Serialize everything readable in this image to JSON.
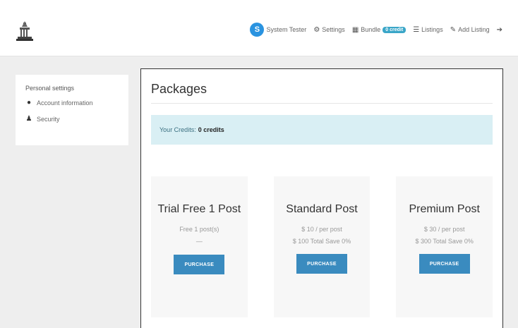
{
  "header": {
    "logo_icon": "building-icon",
    "avatar_letter": "S",
    "user_name": "System Tester",
    "settings_label": "Settings",
    "credits_nav_label": "Bundle",
    "credits_badge": "0 credit",
    "list_label": "Listings",
    "post_label": "Add Listing",
    "logout_icon": "sign-out-icon"
  },
  "sidebar": {
    "heading": "Personal settings",
    "items": [
      {
        "label": "Account information",
        "icon": "user-circle-icon"
      },
      {
        "label": "Security",
        "icon": "users-icon"
      }
    ]
  },
  "main": {
    "title": "Packages",
    "credits_prefix": "Your Credits:",
    "credits_value": "0 credits",
    "packages": [
      {
        "name": "Trial Free 1 Post",
        "line1": "Free 1 post(s)",
        "line2": "—",
        "button": "PURCHASE"
      },
      {
        "name": "Standard Post",
        "line1": "$ 10 / per post",
        "line2": "$ 100 Total Save 0%",
        "button": "PURCHASE"
      },
      {
        "name": "Premium Post",
        "line1": "$ 30 / per post",
        "line2": "$ 300 Total Save 0%",
        "button": "PURCHASE"
      }
    ]
  },
  "colors": {
    "accent": "#3a8bbf",
    "avatar": "#2a93e0",
    "info_bg": "#d9eff4",
    "badge": "#3aa6c8"
  }
}
